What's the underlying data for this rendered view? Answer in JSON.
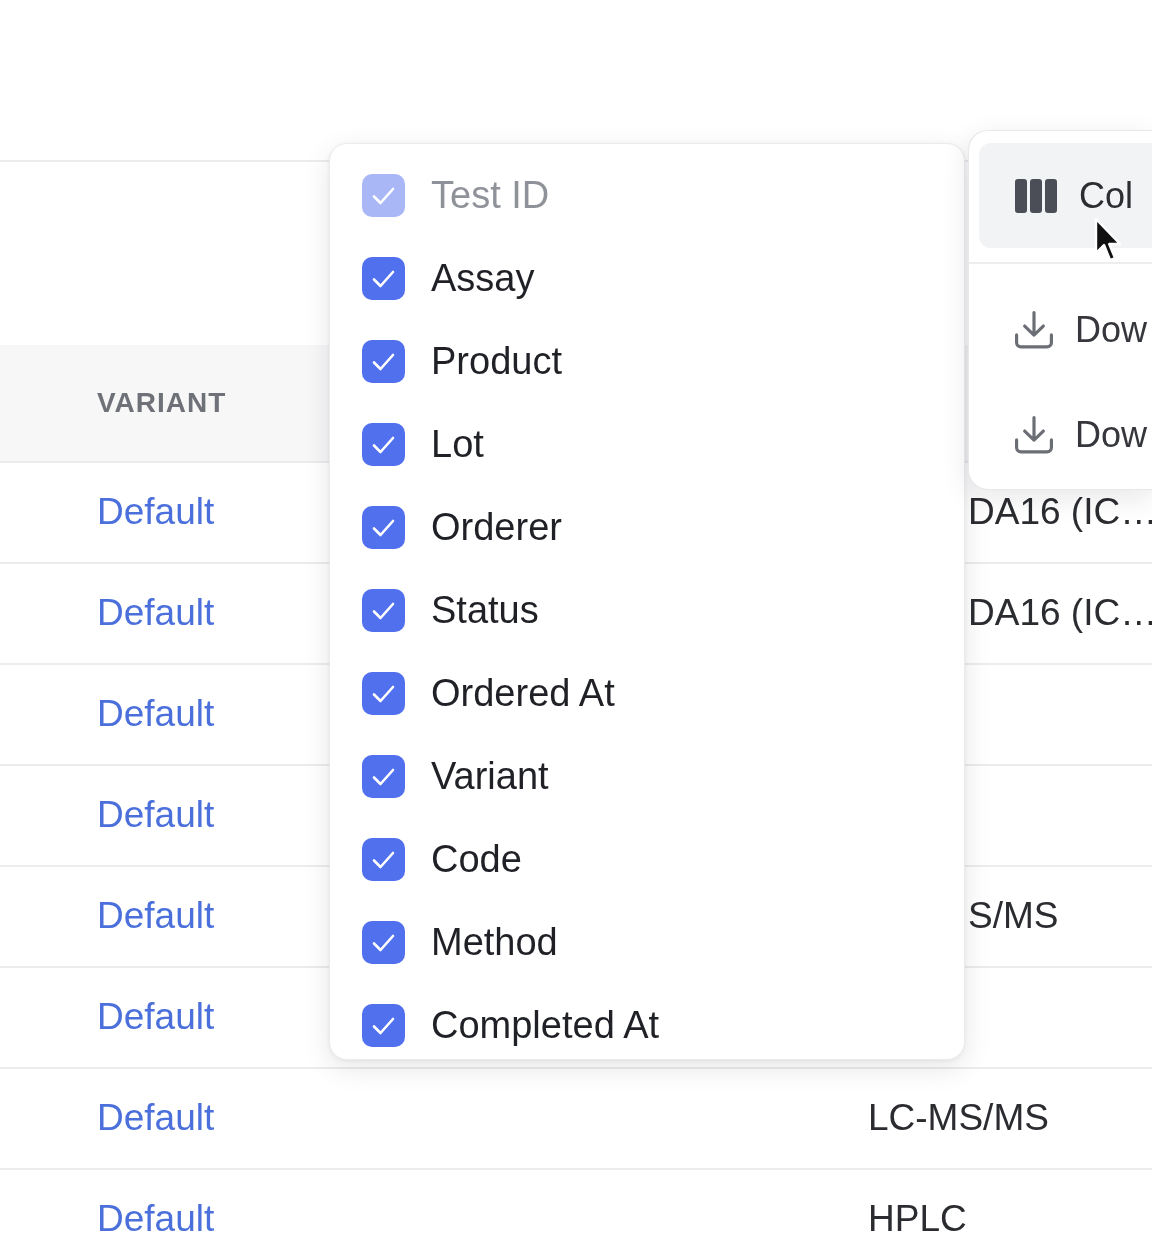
{
  "table": {
    "columns": [
      {
        "label": "VARIANT"
      }
    ],
    "rows": [
      {
        "variant": "Default",
        "column_2": "DA16 (IC…"
      },
      {
        "variant": "Default",
        "column_2": "DA16 (IC…"
      },
      {
        "variant": "Default"
      },
      {
        "variant": "Default"
      },
      {
        "variant": "Default",
        "column_2": "S/MS"
      },
      {
        "variant": "Default"
      },
      {
        "variant": "Default",
        "column_2": "LC-MS/MS"
      },
      {
        "variant": "Default",
        "column_2": "HPLC"
      }
    ]
  },
  "column_menu": {
    "items": [
      {
        "label": "Test ID",
        "checked": true,
        "disabled": true
      },
      {
        "label": "Assay",
        "checked": true,
        "disabled": false
      },
      {
        "label": "Product",
        "checked": true,
        "disabled": false
      },
      {
        "label": "Lot",
        "checked": true,
        "disabled": false
      },
      {
        "label": "Orderer",
        "checked": true,
        "disabled": false
      },
      {
        "label": "Status",
        "checked": true,
        "disabled": false
      },
      {
        "label": "Ordered At",
        "checked": true,
        "disabled": false
      },
      {
        "label": "Variant",
        "checked": true,
        "disabled": false
      },
      {
        "label": "Code",
        "checked": true,
        "disabled": false
      },
      {
        "label": "Method",
        "checked": true,
        "disabled": false
      },
      {
        "label": "Completed At",
        "checked": true,
        "disabled": false
      }
    ]
  },
  "actions_menu": {
    "items": [
      {
        "kind": "columns",
        "label": "Col",
        "highlighted": true
      },
      {
        "kind": "download",
        "label": "Dow",
        "highlighted": false
      },
      {
        "kind": "download",
        "label": "Dow",
        "highlighted": false
      }
    ]
  }
}
